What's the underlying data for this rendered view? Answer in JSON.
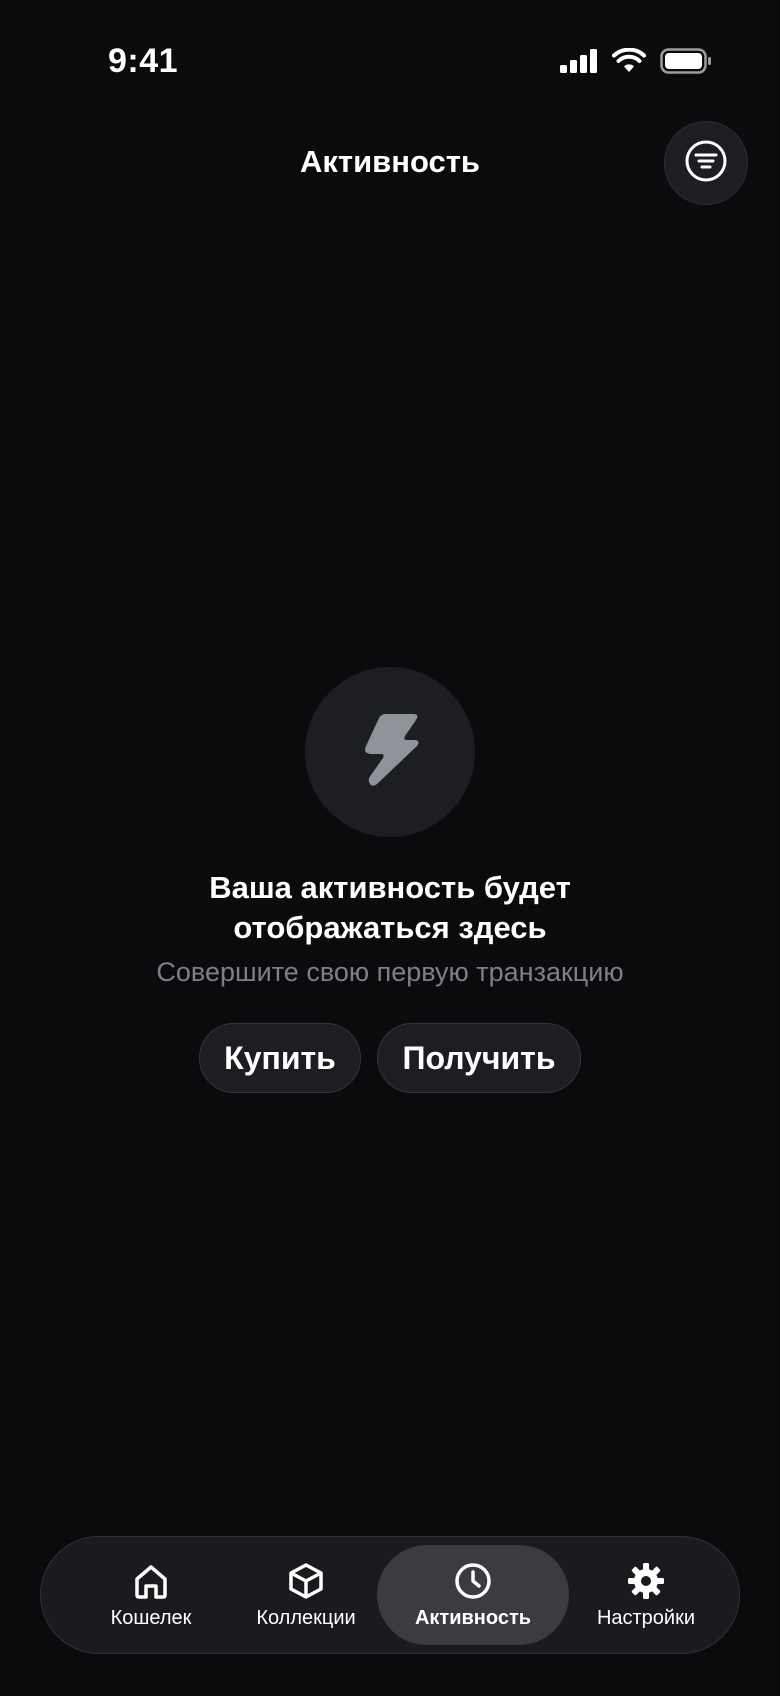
{
  "status_bar": {
    "time": "9:41"
  },
  "header": {
    "title": "Активность",
    "filter_icon": "filter-lines-icon"
  },
  "empty_state": {
    "icon": "lightning-bolt-icon",
    "title_line1": "Ваша активность будет",
    "title_line2": "отображаться здесь",
    "subtitle": "Совершите свою первую транзакцию",
    "buy_label": "Купить",
    "receive_label": "Получить"
  },
  "tab_bar": {
    "items": [
      {
        "label": "Кошелек",
        "icon": "home-icon",
        "active": false
      },
      {
        "label": "Коллекции",
        "icon": "cube-icon",
        "active": false
      },
      {
        "label": "Активность",
        "icon": "clock-icon",
        "active": true
      },
      {
        "label": "Настройки",
        "icon": "gear-icon",
        "active": false
      }
    ]
  },
  "colors": {
    "background": "#0b0b0d",
    "surface": "#1c1e21",
    "active_tab": "#3a3c40",
    "muted_text": "#7d8085",
    "bolt": "#8f949b"
  }
}
